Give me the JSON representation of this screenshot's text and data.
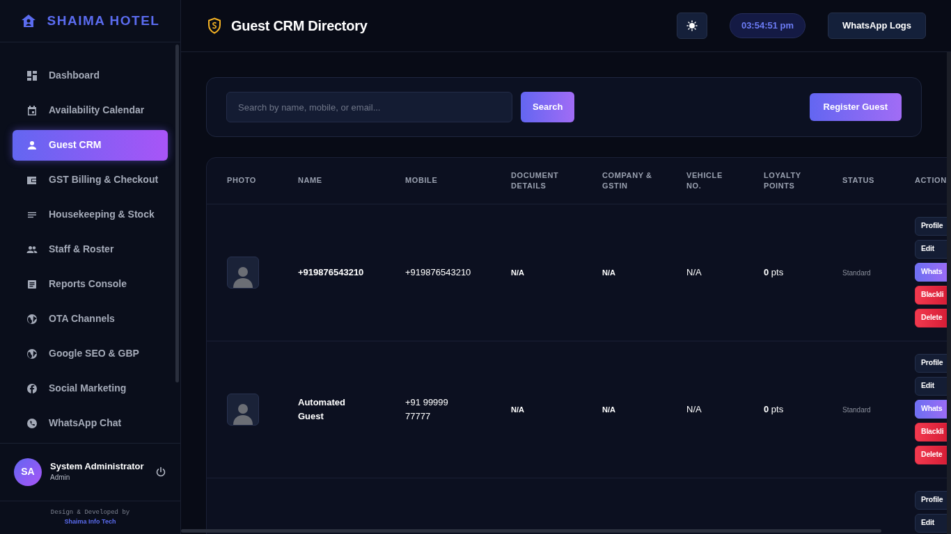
{
  "brand": "SHAIMA HOTEL",
  "sidebar": {
    "items": [
      {
        "label": "Dashboard",
        "selected": false
      },
      {
        "label": "Availability Calendar",
        "selected": false
      },
      {
        "label": "Guest CRM",
        "selected": true
      },
      {
        "label": "GST Billing & Checkout",
        "selected": false
      },
      {
        "label": "Housekeeping & Stock",
        "selected": false
      },
      {
        "label": "Staff & Roster",
        "selected": false
      },
      {
        "label": "Reports Console",
        "selected": false
      },
      {
        "label": "OTA Channels",
        "selected": false
      },
      {
        "label": "Google SEO & GBP",
        "selected": false
      },
      {
        "label": "Social Marketing",
        "selected": false
      },
      {
        "label": "WhatsApp Chat",
        "selected": false
      }
    ]
  },
  "user": {
    "initials": "SA",
    "name": "System Administrator",
    "role": "Admin"
  },
  "credit": {
    "text": "Design & Developed by",
    "company": "Shaima Info Tech"
  },
  "header": {
    "title": "Guest CRM Directory",
    "clock": "03:54:51 pm",
    "logs_button": "WhatsApp Logs"
  },
  "search": {
    "placeholder": "Search by name, mobile, or email...",
    "button": "Search",
    "register_button": "Register Guest"
  },
  "table": {
    "columns": [
      "PHOTO",
      "NAME",
      "MOBILE",
      "DOCUMENT DETAILS",
      "COMPANY & GSTIN",
      "VEHICLE NO.",
      "LOYALTY POINTS",
      "STATUS",
      "ACTION"
    ],
    "rows": [
      {
        "photo": true,
        "name": "+919876543210",
        "mobile": "+919876543210",
        "document": "N/A",
        "company": "N/A",
        "vehicle": "N/A",
        "loyalty": "**0** pts",
        "status": "Standard",
        "actions": [
          {
            "label": "Profile",
            "kind": "plain"
          },
          {
            "label": "Edit",
            "kind": "plain"
          },
          {
            "label": "Whats",
            "kind": "accent"
          },
          {
            "label": "Blackli",
            "kind": "danger"
          },
          {
            "label": "Delete",
            "kind": "danger"
          }
        ]
      },
      {
        "photo": true,
        "name": "Automated Guest",
        "mobile": "+91 99999 77777",
        "document": "N/A",
        "company": "N/A",
        "vehicle": "N/A",
        "loyalty": "**0** pts",
        "status": "Standard",
        "actions": [
          {
            "label": "Profile",
            "kind": "plain"
          },
          {
            "label": "Edit",
            "kind": "plain"
          },
          {
            "label": "Whats",
            "kind": "accent"
          },
          {
            "label": "Blackli",
            "kind": "danger"
          },
          {
            "label": "Delete",
            "kind": "danger"
          }
        ]
      },
      {
        "photo": false,
        "actions": [
          {
            "label": "Profile",
            "kind": "plain"
          },
          {
            "label": "Edit",
            "kind": "plain"
          }
        ]
      }
    ]
  }
}
